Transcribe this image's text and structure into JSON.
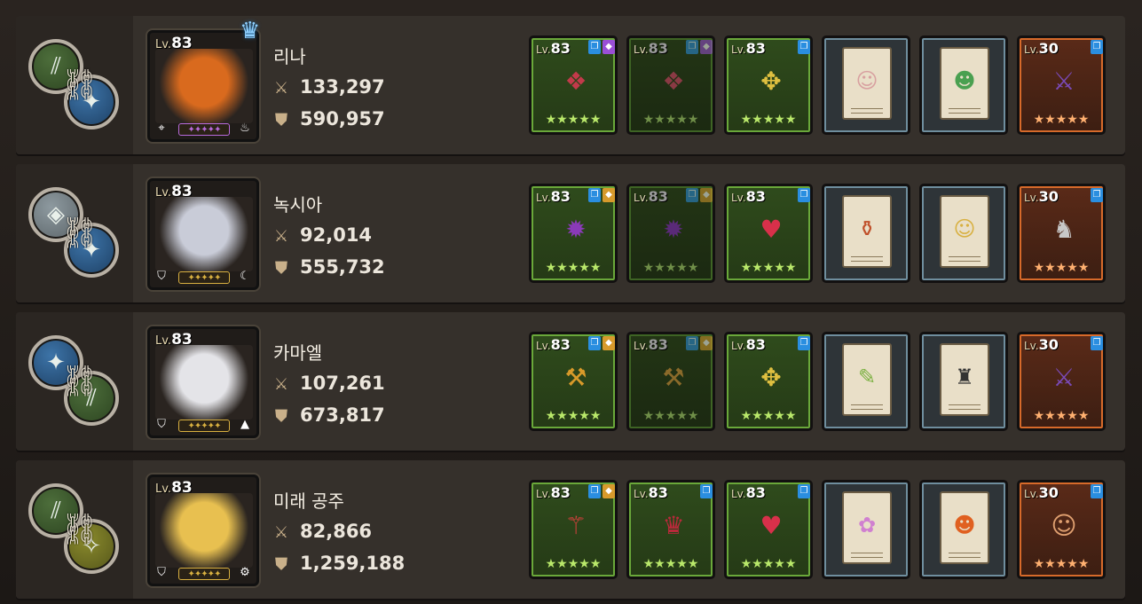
{
  "rows": [
    {
      "name": "리나",
      "level": "83",
      "attack": "133,297",
      "defense": "590,957",
      "crown": true,
      "portrait_color": "#d96a1e",
      "stars": "✦✦✦✦✦",
      "stars_color": "#b86adb",
      "class_icon": "bow-icon",
      "element_icon": "fire-icon",
      "chain_left": "green",
      "chain_right": "blue",
      "slots": [
        {
          "type": "green",
          "lv": "83",
          "tags": [
            "blue",
            "purple"
          ],
          "item": "ring-icon",
          "glyph": "❖",
          "color": "#c23a4a"
        },
        {
          "type": "green dim",
          "lv": "83",
          "tags": [
            "blue",
            "purple"
          ],
          "item": "ring-icon",
          "glyph": "❖",
          "color": "#8a3a44"
        },
        {
          "type": "green",
          "lv": "83",
          "tags": [
            "blue"
          ],
          "item": "amulet-icon",
          "glyph": "✥",
          "color": "#e0c040"
        },
        {
          "type": "card",
          "item": "card-portrait-icon",
          "glyph": "☺",
          "color": "#d8a0a0"
        },
        {
          "type": "card",
          "item": "card-portrait-icon",
          "glyph": "☻",
          "color": "#4aa050"
        },
        {
          "type": "orange",
          "lv": "30",
          "tags": [
            "blue"
          ],
          "item": "relic-icon",
          "glyph": "⚔",
          "color": "#7a4ab8"
        }
      ]
    },
    {
      "name": "녹시아",
      "level": "83",
      "attack": "92,014",
      "defense": "555,732",
      "crown": false,
      "portrait_color": "#c9ccd8",
      "stars": "✦✦✦✦✦",
      "stars_color": "#d8b040",
      "class_icon": "shield-icon",
      "element_icon": "moon-icon",
      "chain_left": "gray",
      "chain_right": "blue",
      "slots": [
        {
          "type": "green",
          "lv": "83",
          "tags": [
            "blue",
            "gold"
          ],
          "item": "orb-icon",
          "glyph": "✹",
          "color": "#8a3ab8"
        },
        {
          "type": "green dim",
          "lv": "83",
          "tags": [
            "blue",
            "gold"
          ],
          "item": "orb-icon",
          "glyph": "✹",
          "color": "#5a2a78"
        },
        {
          "type": "green",
          "lv": "83",
          "tags": [
            "blue"
          ],
          "item": "amulet-icon",
          "glyph": "♥",
          "color": "#d8304a"
        },
        {
          "type": "card",
          "item": "card-portrait-icon",
          "glyph": "⚱",
          "color": "#c0502a"
        },
        {
          "type": "card",
          "item": "card-portrait-icon",
          "glyph": "☺",
          "color": "#d8b040"
        },
        {
          "type": "orange",
          "lv": "30",
          "tags": [
            "blue"
          ],
          "item": "relic-icon",
          "glyph": "♞",
          "color": "#c8c8c8"
        }
      ]
    },
    {
      "name": "카마엘",
      "level": "83",
      "attack": "107,261",
      "defense": "673,817",
      "crown": false,
      "portrait_color": "#e4e4e8",
      "stars": "✦✦✦✦✦",
      "stars_color": "#d8b040",
      "class_icon": "shield-icon",
      "element_icon": "mountain-icon",
      "chain_left": "blue",
      "chain_right": "green",
      "slots": [
        {
          "type": "green",
          "lv": "83",
          "tags": [
            "blue",
            "gold"
          ],
          "item": "scythe-icon",
          "glyph": "⚒",
          "color": "#d89a2a"
        },
        {
          "type": "green dim",
          "lv": "83",
          "tags": [
            "blue",
            "gold"
          ],
          "item": "scythe-icon",
          "glyph": "⚒",
          "color": "#8a6a2a"
        },
        {
          "type": "green",
          "lv": "83",
          "tags": [
            "blue"
          ],
          "item": "amulet-icon",
          "glyph": "✥",
          "color": "#e0c040"
        },
        {
          "type": "card",
          "item": "card-portrait-icon",
          "glyph": "✎",
          "color": "#7ab040"
        },
        {
          "type": "card",
          "item": "card-portrait-icon",
          "glyph": "♜",
          "color": "#333"
        },
        {
          "type": "orange",
          "lv": "30",
          "tags": [
            "blue"
          ],
          "item": "relic-icon",
          "glyph": "⚔",
          "color": "#7a4ab8"
        }
      ]
    },
    {
      "name": "미래 공주",
      "level": "83",
      "attack": "82,866",
      "defense": "1,259,188",
      "crown": false,
      "portrait_color": "#e8c050",
      "stars": "✦✦✦✦✦",
      "stars_color": "#d8b040",
      "class_icon": "shield-icon",
      "element_icon": "gear-icon",
      "chain_left": "green",
      "chain_right": "olive",
      "slots": [
        {
          "type": "green",
          "lv": "83",
          "tags": [
            "blue",
            "gold"
          ],
          "item": "staff-icon",
          "glyph": "⚚",
          "color": "#e04040"
        },
        {
          "type": "green",
          "lv": "83",
          "tags": [
            "blue"
          ],
          "item": "armor-icon",
          "glyph": "♛",
          "color": "#b82a3a"
        },
        {
          "type": "green",
          "lv": "83",
          "tags": [
            "blue"
          ],
          "item": "amulet-icon",
          "glyph": "♥",
          "color": "#d8304a"
        },
        {
          "type": "card",
          "item": "card-portrait-icon",
          "glyph": "✿",
          "color": "#d080d0"
        },
        {
          "type": "card",
          "item": "card-portrait-icon",
          "glyph": "☻",
          "color": "#e06020"
        },
        {
          "type": "orange",
          "lv": "30",
          "tags": [
            "blue"
          ],
          "item": "relic-icon",
          "glyph": "☺",
          "color": "#e0a070"
        }
      ]
    }
  ],
  "labels": {
    "lv": "Lv.",
    "star_row": "★★★★★"
  },
  "colors": {
    "panel": "#35302b",
    "accent_green": "#6aa83a",
    "accent_orange": "#d76a2a",
    "accent_card": "#6f8e9e"
  }
}
